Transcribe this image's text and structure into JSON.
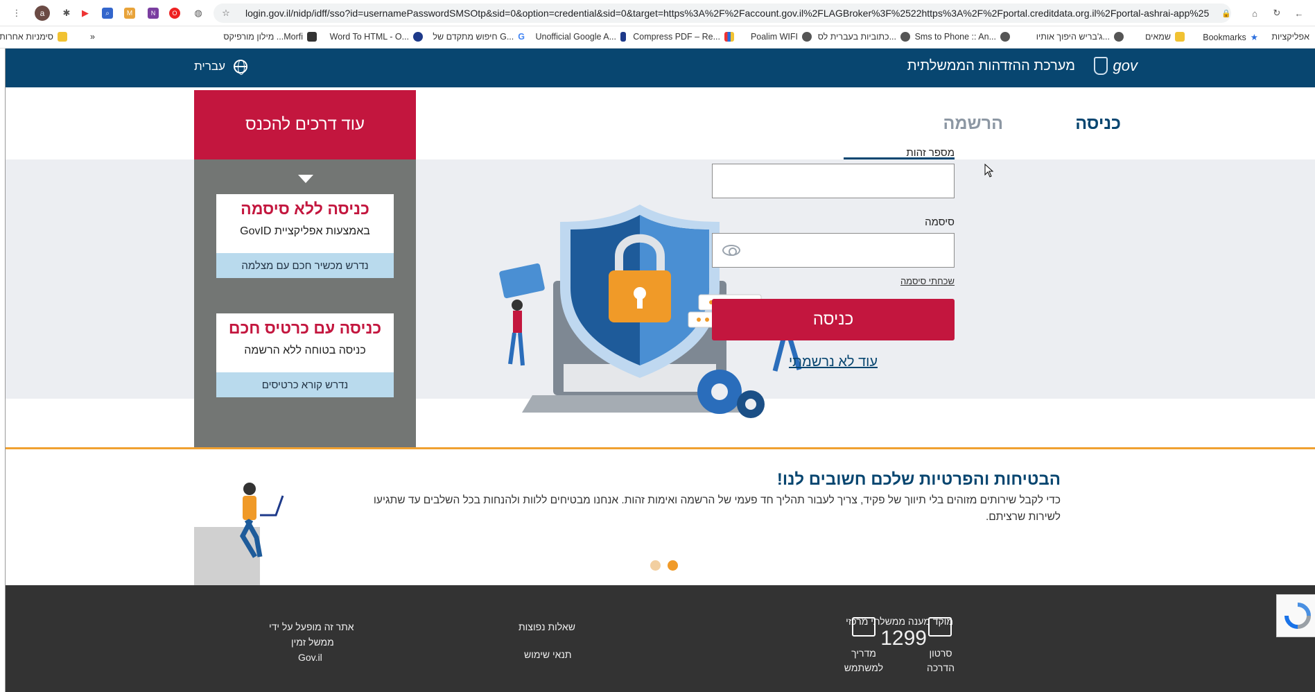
{
  "browser": {
    "url": "login.gov.il/nidp/idff/sso?id=usernamePasswordSMSOtp&sid=0&option=credential&sid=0&target=https%3A%2F%2Faccount.gov.il%2FLAGBroker%3F%2522https%3A%2F%2Fportal.creditdata.org.il%2Fportal-ashrai-app%2522",
    "avatar_letter": "a",
    "bookmarks": [
      {
        "label": "אפליקציות",
        "icon": "apps-icon"
      },
      {
        "label": "Bookmarks",
        "icon": "star-icon"
      },
      {
        "label": "שמאים",
        "icon": "folder-icon"
      },
      {
        "label": "ג'בריש היפוך אותיו...",
        "icon": "globe-icon"
      },
      {
        "label": "Sms to Phone :: An...",
        "icon": "globe-icon"
      },
      {
        "label": "כתוביות בעברית לס...",
        "icon": "globe-icon"
      },
      {
        "label": "Poalim WIFI",
        "icon": "wifi-icon"
      },
      {
        "label": "Compress PDF – Re...",
        "icon": "pdf-icon"
      },
      {
        "label": "Unofficial Google A...",
        "icon": "bookmark-icon"
      },
      {
        "label": "חיפוש מתקדם של G...",
        "icon": "google-icon"
      },
      {
        "label": "Word To HTML - O...",
        "icon": "word-icon"
      },
      {
        "label": "מילון מורפיקס ...Morfi",
        "icon": "morfix-icon"
      },
      {
        "label": "»",
        "icon": ""
      },
      {
        "label": "סימניות אחרות",
        "icon": "folder-icon"
      }
    ]
  },
  "header": {
    "title": "מערכת ההזדהות הממשלתית",
    "logo_text": "gov",
    "language": "עברית"
  },
  "tabs": {
    "login": "כניסה",
    "register": "הרשמה"
  },
  "form": {
    "id_label": "מספר זהות",
    "password_label": "סיסמה",
    "forgot": "שכחתי סיסמה",
    "submit": "כניסה",
    "not_registered": "עוד לא נרשמתי"
  },
  "other_ways": {
    "heading": "עוד דרכים להכנס",
    "cards": [
      {
        "title": "כניסה ללא סיסמה",
        "subtitle": "באמצעות אפליקציית GovID",
        "footer": "נדרש מכשיר חכם עם מצלמה"
      },
      {
        "title": "כניסה עם כרטיס חכם",
        "subtitle": "כניסה בטוחה ללא הרשמה",
        "footer": "נדרש קורא כרטיסים"
      }
    ]
  },
  "info": {
    "title": "הבטיחות והפרטיות שלכם חשובים לנו!",
    "text": "כדי לקבל שירותים מזוהים בלי תיווך של פקיד, צריך לעבור תהליך חד פעמי של הרשמה ואימות זהות. אנחנו מבטיחים ללוות ולהנחות בכל השלבים עד שתגיעו לשירות שרציתם."
  },
  "footer": {
    "hotline_label": "מוקד מענה ממשלתי מרכזי",
    "hotline_number": "1299",
    "video_label": "סרטון הדרכה",
    "guide_label": "מדריך למשתמש",
    "faq": "שאלות נפוצות",
    "terms": "תנאי שימוש",
    "operated_by": "אתר זה מופעל על ידי",
    "operated_by_2": "ממשל זמין",
    "operated_by_3": "Gov.il"
  },
  "colors": {
    "header_blue": "#084670",
    "accent_red": "#c3163e",
    "panel_gray": "#737674",
    "orange": "#f0a030"
  }
}
